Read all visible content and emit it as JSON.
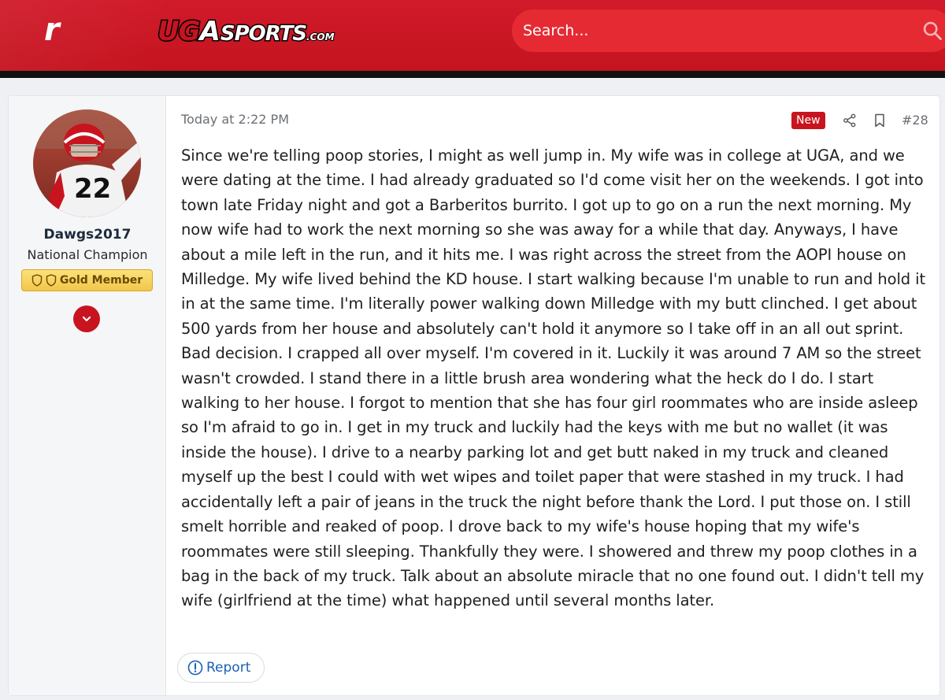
{
  "header": {
    "brand_mark": "r",
    "site_logo_text": {
      "uga": "UG",
      "a": "A",
      "sports": "SPORTS",
      "com": ".COM"
    },
    "search_placeholder": "Search..."
  },
  "post": {
    "author": {
      "username": "Dawgs2017",
      "title": "National Champion",
      "badge": "Gold Member"
    },
    "date": "Today at 2:22 PM",
    "new_label": "New",
    "post_number": "#28",
    "body": "Since we're telling poop stories, I might as well jump in. My wife was in college at UGA, and we were dating at the time. I had already graduated so I'd come visit her on the weekends. I got into town late Friday night and got a Barberitos burrito. I got up to go on a run the next morning. My now wife had to work the next morning so she was away for a while that day. Anyways, I have about a mile left in the run, and it hits me. I was right across the street from the AOPI house on Milledge. My wife lived behind the KD house. I start walking because I'm unable to run and hold it in at the same time. I'm literally power walking down Milledge with my butt clinched. I get about 500 yards from her house and absolutely can't hold it anymore so I take off in an all out sprint. Bad decision. I crapped all over myself. I'm covered in it. Luckily it was around 7 AM so the street wasn't crowded. I stand there in a little brush area wondering what the heck do I do. I start walking to her house. I forgot to mention that she has four girl roommates who are inside asleep so I'm afraid to go in. I get in my truck and luckily had the keys with me but no wallet (it was inside the house). I drive to a nearby parking lot and get butt naked in my truck and cleaned myself up the best I could with wet wipes and toilet paper that were stashed in my truck. I had accidentally left a pair of jeans in the truck the night before thank the Lord. I put those on. I still smelt horrible and reaked of poop. I drove back to my wife's house hoping that my wife's roommates were still sleeping. Thankfully they were. I showered and threw my poop clothes in a bag in the back of my truck. Talk about an absolute miracle that no one found out. I didn't tell my wife (girlfriend at the time) what happened until several months later.",
    "report_label": "Report"
  },
  "colors": {
    "brand_red": "#c8141f",
    "header_red": "#d11a2a",
    "link_blue": "#1a5fb4",
    "badge_gold": "#f2c64a"
  },
  "icons": [
    "search-icon",
    "share-icon",
    "bookmark-icon",
    "shield-icon",
    "chevron-down-icon",
    "alert-circle-icon"
  ]
}
